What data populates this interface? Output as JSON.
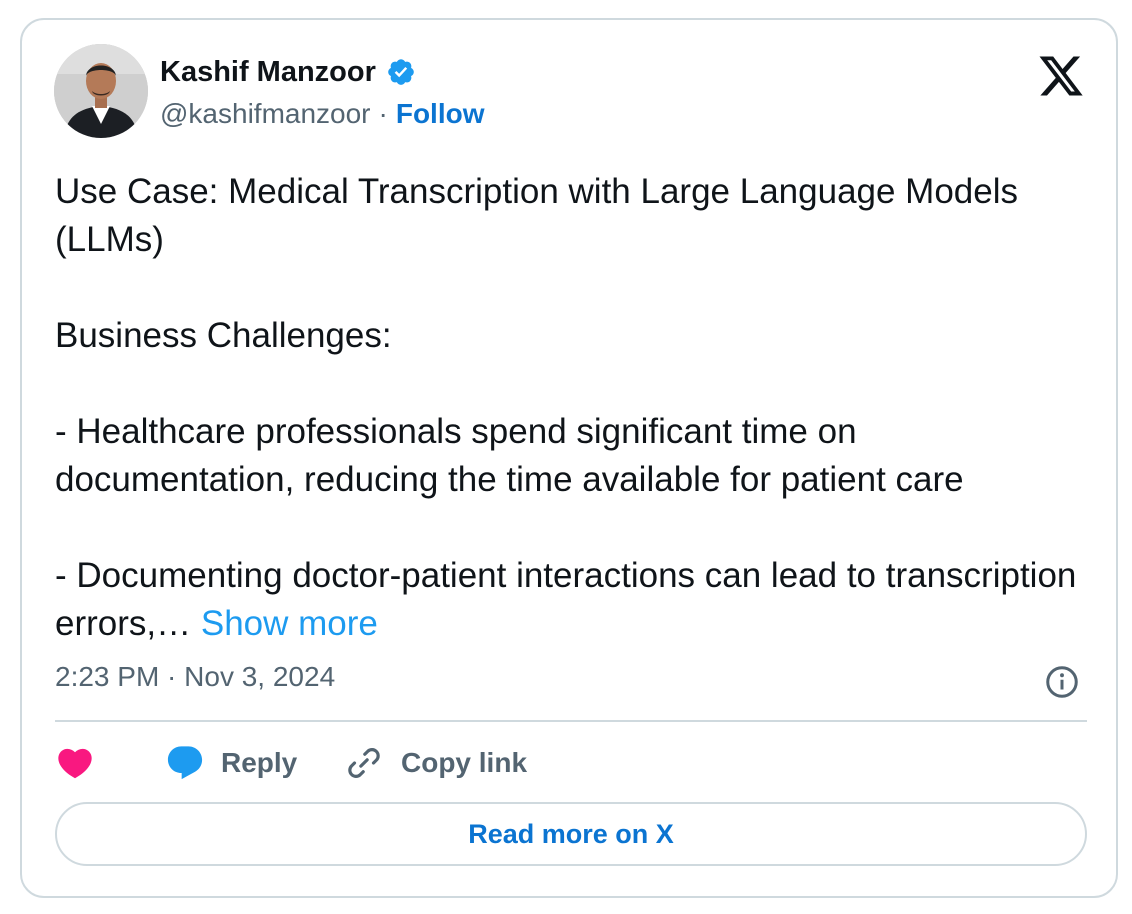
{
  "author": {
    "name": "Kashif Manzoor",
    "handle": "@kashifmanzoor",
    "separator": "·",
    "follow_label": "Follow",
    "verified": true
  },
  "tweet": {
    "title_line": "Use Case: Medical Transcription with Large Language Models (LLMs)",
    "section_heading": "Business Challenges:",
    "bullet_1": "- Healthcare professionals spend significant time on documentation, reducing the time available for patient care",
    "bullet_2": "- Documenting doctor-patient interactions can lead to transcription errors,…",
    "show_more_label": "Show more",
    "timestamp": "2:23 PM · Nov 3, 2024"
  },
  "actions": {
    "reply_label": "Reply",
    "copy_link_label": "Copy link"
  },
  "footer": {
    "read_more_label": "Read more on X"
  },
  "icons": {
    "platform": "x-logo-icon",
    "verified": "verified-badge-icon",
    "like": "heart-icon",
    "reply": "speech-bubble-icon",
    "copy": "link-icon",
    "info": "info-icon"
  },
  "colors": {
    "link_blue": "#1d9bf0",
    "follow_blue": "#0b74d1",
    "like_pink": "#f91880",
    "muted": "#536471",
    "border": "#cfd9de"
  }
}
